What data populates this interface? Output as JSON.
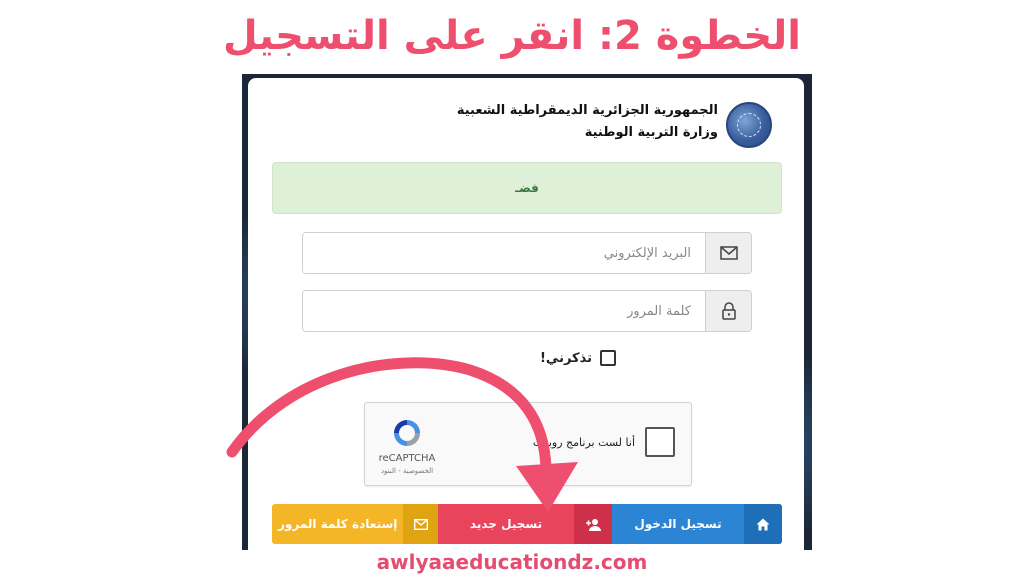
{
  "heading": "الخطوة 2: انقر على التسجيل",
  "ministry": {
    "line1": "الجمهورية الجزائرية الديمقراطية الشعبية",
    "line2": "وزارة التربية الوطنية"
  },
  "alert_text": "فضـ",
  "email": {
    "placeholder": "البريد الإلكتروني",
    "value": ""
  },
  "password": {
    "placeholder": "كلمة المرور",
    "value": ""
  },
  "remember": {
    "label": "تذكرني!",
    "checked": false
  },
  "captcha": {
    "text": "أنا لست برنامج روبوت",
    "brand": "reCAPTCHA",
    "links": "الخصوصية - البنود"
  },
  "buttons": {
    "reset": "إستعادة كلمة المرور",
    "register": "تسجيل جديد",
    "login": "تسجيل الدخول"
  },
  "footer": "awlyaaeducationdz.com",
  "colors": {
    "heading": "#ef4f6f",
    "arrow": "#ef4f6f",
    "login": "#2b85d4",
    "register": "#e8455d",
    "reset": "#f4b526",
    "alert_bg": "#dff0d8"
  },
  "icons": {
    "email": "envelope-icon",
    "password": "lock-icon",
    "reset": "envelope-icon",
    "register": "user-plus-icon",
    "login": "home-icon",
    "logo": "ministry-seal"
  }
}
